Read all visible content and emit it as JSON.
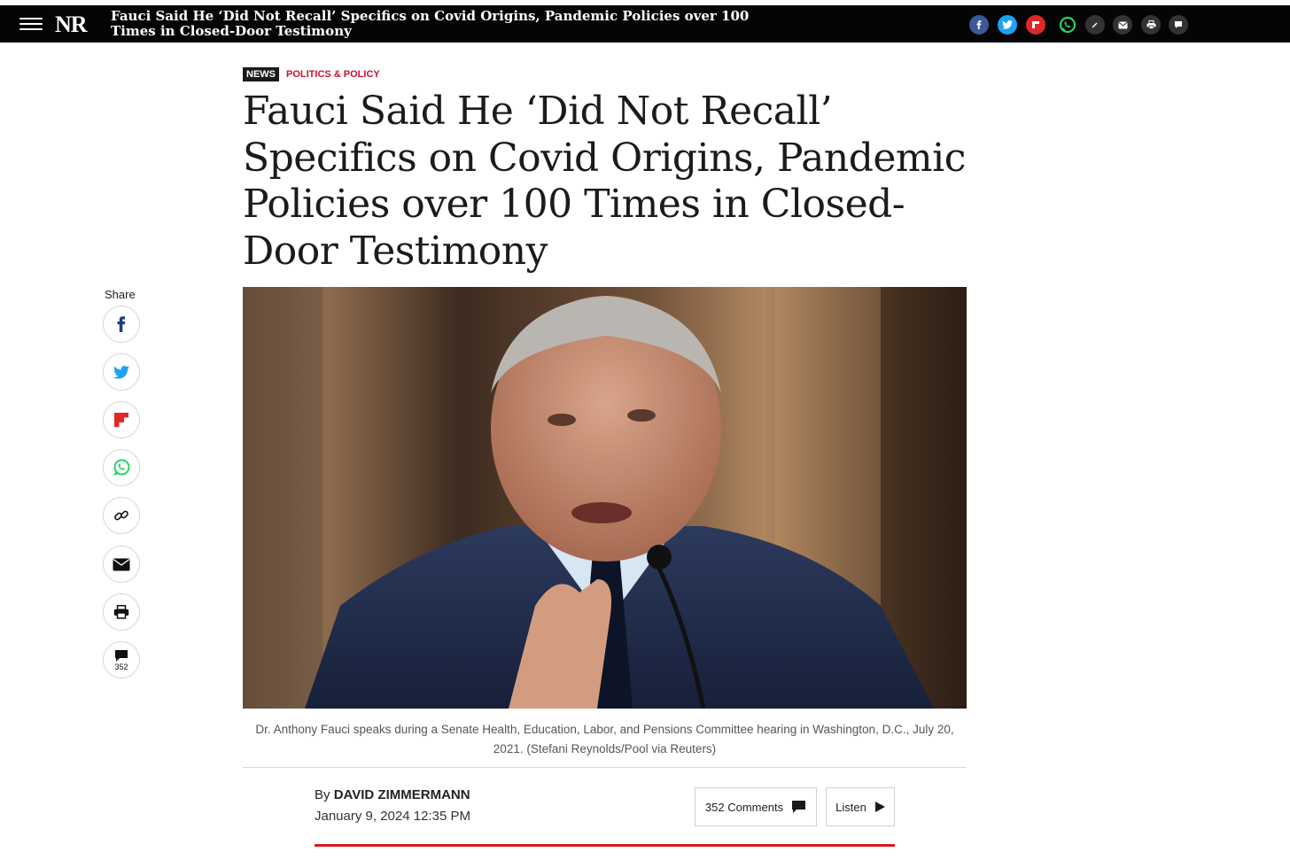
{
  "topbar": {
    "logo": "NR",
    "title": "Fauci Said He ‘Did Not Recall’ Specifics on Covid Origins, Pandemic Policies over 100 Times in Closed-Door Testimony",
    "share_icons": [
      "facebook-icon",
      "twitter-icon",
      "flipboard-icon",
      "whatsapp-icon",
      "link-icon",
      "email-icon",
      "print-icon",
      "comment-icon"
    ]
  },
  "article": {
    "tag": "News",
    "section": "Politics & Policy",
    "headline": "Fauci Said He ‘Did Not Recall’ Specifics on Covid Origins, Pandemic Policies over 100 Times in Closed-Door Testimony",
    "caption": "Dr. Anthony Fauci speaks during a Senate Health, Education, Labor, and Pensions Committee hearing in Washington, D.C., July 20, 2021. (Stefani Reynolds/Pool via Reuters)",
    "byline_prefix": "By",
    "author": "David Zimmermann",
    "date": "January 9, 2024 12:35 PM"
  },
  "share_rail": {
    "label": "Share",
    "comment_count": "352"
  },
  "actions": {
    "comments_label": "352 Comments",
    "listen_label": "Listen"
  },
  "colors": {
    "accent_red": "#c8102e",
    "facebook": "#3b5998",
    "twitter": "#1da1f2",
    "flipboard": "#e12828",
    "whatsapp": "#25d366"
  }
}
